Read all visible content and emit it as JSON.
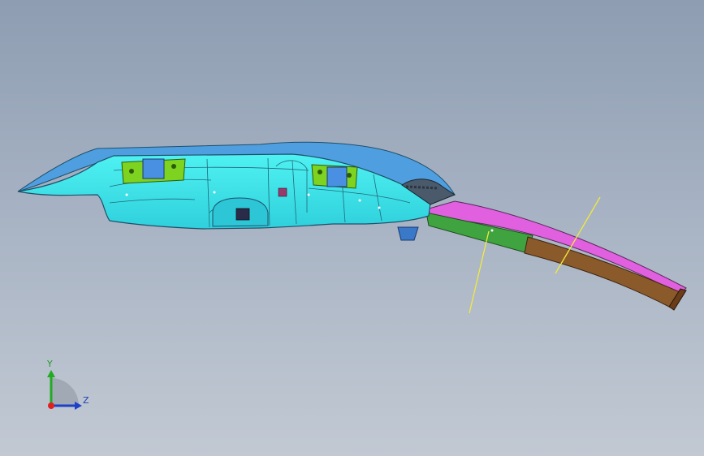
{
  "viewport": {
    "background_top": "#8e9db2",
    "background_bottom": "#c2c9d3"
  },
  "triad": {
    "y_label": "Y",
    "z_label": "Z",
    "y_color": "#22aa22",
    "z_color": "#1e40c8",
    "x_color": "#e02020"
  },
  "part": {
    "body_color": "#35e6e6",
    "edge_color": "#1f4f6a",
    "top_color": "#4f9fe0",
    "bracket_color": "#7ed321",
    "clip_color": "#4a90e2",
    "rail_top_color": "#e060e0",
    "rail_green_color": "#3fa43f",
    "rail_brown_color": "#8b5a2b",
    "guide_color": "#f2ea3a"
  }
}
